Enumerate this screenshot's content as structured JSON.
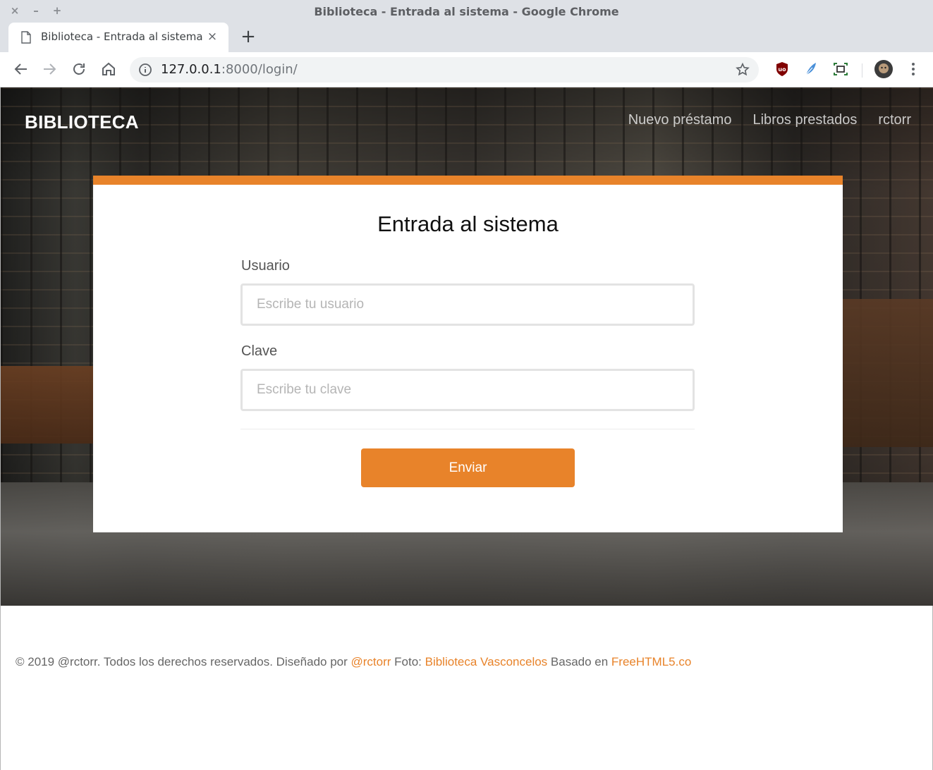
{
  "window": {
    "title": "Biblioteca - Entrada al sistema - Google Chrome",
    "controls": [
      "×",
      "–",
      "+"
    ]
  },
  "tab": {
    "title": "Biblioteca - Entrada al sistema",
    "close": "×",
    "new_tab": "+"
  },
  "toolbar": {
    "url_host": "127.0.0.1",
    "url_rest": ":8000/login/",
    "icons": [
      "back-icon",
      "forward-icon",
      "reload-icon",
      "home-icon",
      "info-icon",
      "star-icon",
      "ublock-icon",
      "feather-icon",
      "screenshot-icon",
      "avatar-icon",
      "menu-icon"
    ]
  },
  "site": {
    "brand": "BIBLIOTECA",
    "nav": [
      "Nuevo préstamo",
      "Libros prestados",
      "rctorr"
    ]
  },
  "login": {
    "title": "Entrada al sistema",
    "user_label": "Usuario",
    "user_placeholder": "Escribe tu usuario",
    "password_label": "Clave",
    "password_placeholder": "Escribe tu clave",
    "submit": "Enviar"
  },
  "footer": {
    "copyright": "© 2019 @rctorr. Todos los derechos reservados. Diseñado por ",
    "designer": "@rctorr",
    "photo_text": " Foto: ",
    "photo_link": "Biblioteca Vasconcelos",
    "based_text": " Basado en ",
    "based_link": "FreeHTML5.co"
  },
  "colors": {
    "accent": "#e8832a",
    "chrome_frame": "#dee1e6"
  }
}
